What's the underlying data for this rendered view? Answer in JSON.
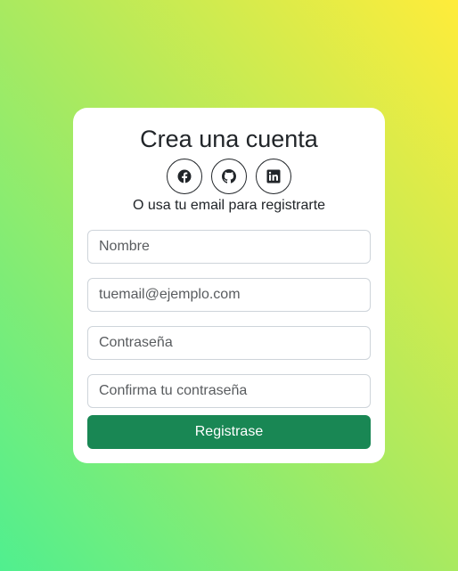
{
  "form": {
    "title": "Crea una cuenta",
    "subtitle": "O usa tu email para registrarte",
    "social": [
      {
        "icon": "facebook-icon"
      },
      {
        "icon": "github-icon"
      },
      {
        "icon": "linkedin-icon"
      }
    ],
    "fields": {
      "name_placeholder": "Nombre",
      "email_placeholder": "tuemail@ejemplo.com",
      "password_placeholder": "Contraseña",
      "confirm_placeholder": "Confirma tu contraseña"
    },
    "submit_label": "Registrase"
  },
  "colors": {
    "primary_button": "#198754",
    "background_gradient_start": "#50ef8f",
    "background_gradient_end": "#ffec3a",
    "text": "#212529"
  }
}
